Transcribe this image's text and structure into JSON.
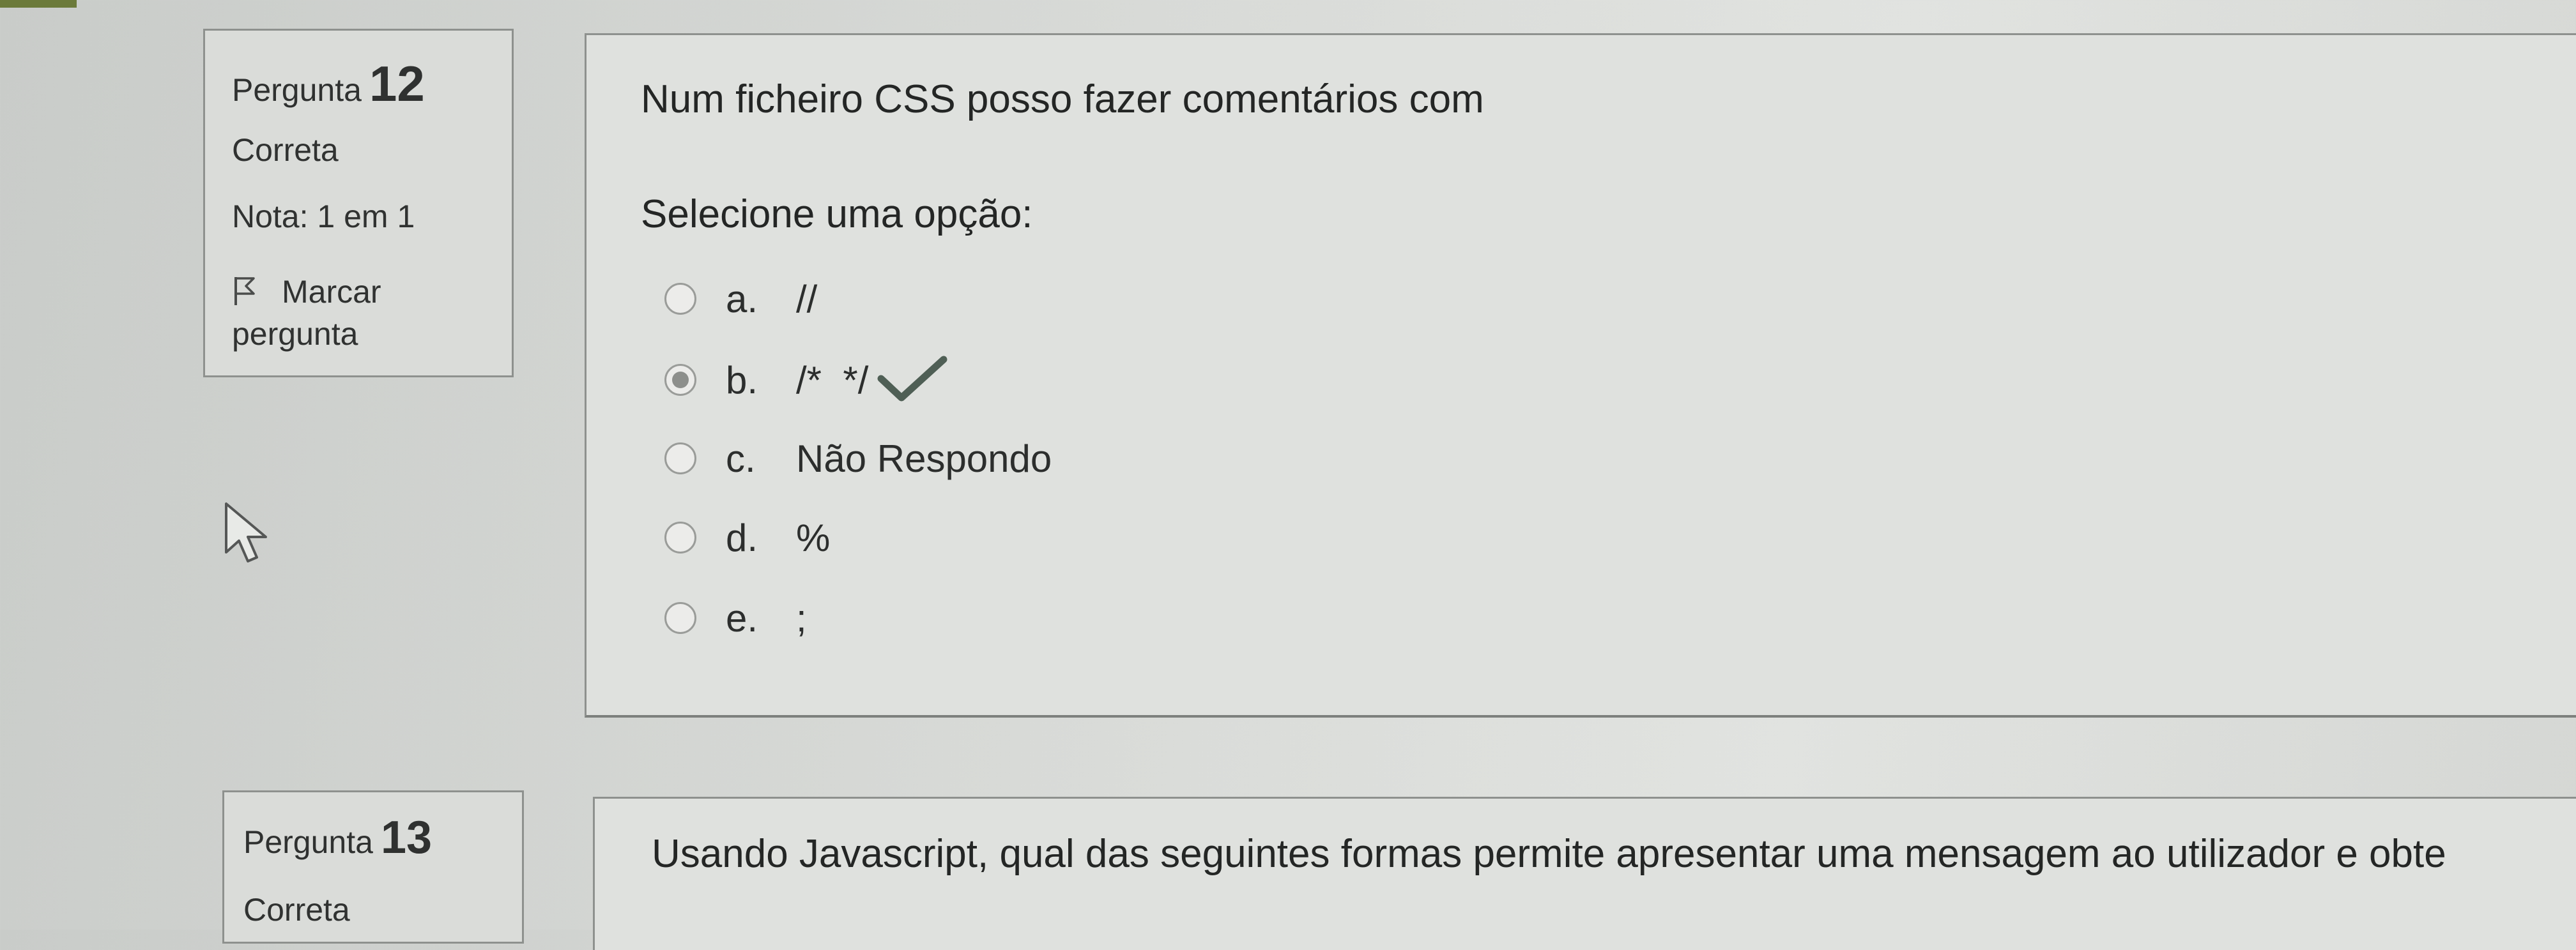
{
  "q12": {
    "label": "Pergunta",
    "number": "12",
    "status": "Correta",
    "grade": "Nota: 1 em 1",
    "flag_line1": "Marcar",
    "flag_line2": "pergunta",
    "text": "Num ficheiro CSS posso fazer comentários com",
    "prompt": "Selecione uma opção:",
    "options": [
      {
        "letter": "a.",
        "text": "//",
        "selected": false
      },
      {
        "letter": "b.",
        "text": "/*  */",
        "selected": true,
        "correct": true
      },
      {
        "letter": "c.",
        "text": "Não Respondo",
        "selected": false
      },
      {
        "letter": "d.",
        "text": "%",
        "selected": false
      },
      {
        "letter": "e.",
        "text": ";",
        "selected": false
      }
    ]
  },
  "q13": {
    "label": "Pergunta",
    "number": "13",
    "status": "Correta",
    "text": "Usando Javascript, qual das seguintes formas permite apresentar uma mensagem ao utilizador e obte"
  },
  "icons": {
    "flag": "flag-icon",
    "check": "checkmark-icon",
    "cursor": "mouse-pointer-icon"
  },
  "colors": {
    "check": "#4f5f55",
    "border": "#8e918e",
    "background": "#dadcd9"
  }
}
